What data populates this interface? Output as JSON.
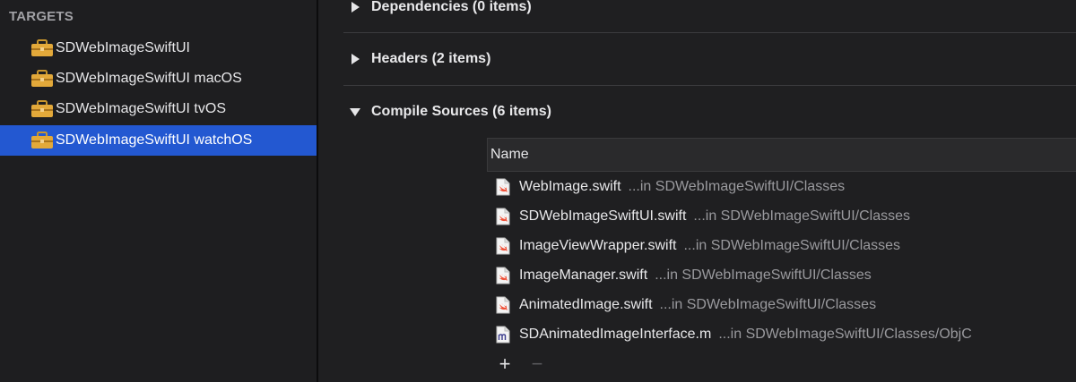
{
  "sidebar": {
    "header": "TARGETS",
    "items": [
      {
        "label": "SDWebImageSwiftUI",
        "selected": false
      },
      {
        "label": "SDWebImageSwiftUI macOS",
        "selected": false
      },
      {
        "label": "SDWebImageSwiftUI tvOS",
        "selected": false
      },
      {
        "label": "SDWebImageSwiftUI watchOS",
        "selected": true
      }
    ],
    "icon": "toolbox-icon",
    "selection_color": "#2358d1"
  },
  "phases": [
    {
      "title": "Dependencies (0 items)",
      "expanded": false
    },
    {
      "title": "Headers (2 items)",
      "expanded": false
    },
    {
      "title": "Compile Sources (6 items)",
      "expanded": true
    }
  ],
  "compile_sources": {
    "column_header": "Name",
    "files": [
      {
        "name": "WebImage.swift",
        "location": "...in SDWebImageSwiftUI/Classes",
        "type": "swift"
      },
      {
        "name": "SDWebImageSwiftUI.swift",
        "location": "...in SDWebImageSwiftUI/Classes",
        "type": "swift"
      },
      {
        "name": "ImageViewWrapper.swift",
        "location": "...in SDWebImageSwiftUI/Classes",
        "type": "swift"
      },
      {
        "name": "ImageManager.swift",
        "location": "...in SDWebImageSwiftUI/Classes",
        "type": "swift"
      },
      {
        "name": "AnimatedImage.swift",
        "location": "...in SDWebImageSwiftUI/Classes",
        "type": "swift"
      },
      {
        "name": "SDAnimatedImageInterface.m",
        "location": "...in SDWebImageSwiftUI/Classes/ObjC",
        "type": "objc"
      }
    ],
    "add_label": "+",
    "remove_label": "−"
  }
}
